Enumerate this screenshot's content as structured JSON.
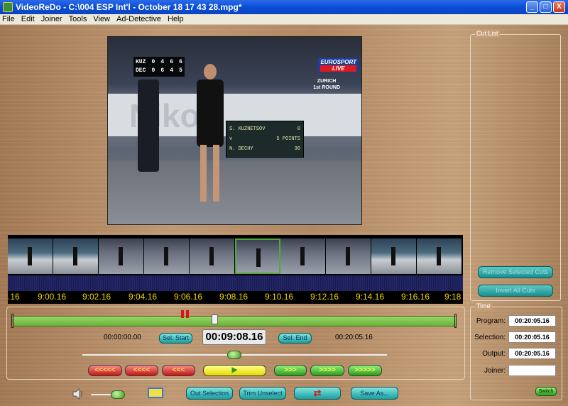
{
  "window": {
    "title": "VideoReDo - C:\\004   ESP Int'l - October 18 17 43 28.mpg*",
    "minimize": "_",
    "maximize": "□",
    "close": "X"
  },
  "menu": [
    "File",
    "Edit",
    "Joiner",
    "Tools",
    "View",
    "Ad-Detective",
    "Help"
  ],
  "video": {
    "score_row1": {
      "abbr": "KUZ",
      "a": "0",
      "b": "4",
      "c": "6",
      "d": "6"
    },
    "score_row2": {
      "abbr": "DEC",
      "a": "0",
      "b": "6",
      "c": "4",
      "d": "5"
    },
    "channel": "EUROSPORT",
    "live": "LIVE",
    "location": "ZURICH",
    "round": "1st ROUND",
    "banner": "Nikon",
    "scoreboard_p1": "S. KUZNETSOV",
    "scoreboard_p1_score": "0",
    "scoreboard_p2": "N. DECHY",
    "scoreboard_p2_score": "30",
    "scoreboard_mid": "v",
    "scoreboard_points": "5 POINTS"
  },
  "timeline": {
    "labels": [
      ".16",
      "9:00.16",
      "9:02.16",
      "9:04.16",
      "9:06.16",
      "9:08.16",
      "9:10.16",
      "9:12.16",
      "9:14.16",
      "9:16.16",
      "9:18"
    ]
  },
  "controls": {
    "selection_start": "00:00:00.00",
    "sel_start_label": "Sel. Start",
    "current_time": "00:09:08.16",
    "sel_end_label": "Sel. End",
    "selection_end": "00:20:05.16",
    "nav_back": [
      "<<<<<",
      "<<<<",
      "<<<"
    ],
    "play": "▶",
    "nav_forward": [
      ">>>",
      ">>>>",
      ">>>>>"
    ],
    "out_selection": "Out Selection",
    "trim_unselect": "Trim Unselect",
    "cycle": "⇄",
    "save_as": "Save As..."
  },
  "cut_list": {
    "title": "Cut List",
    "remove_selected": "Remove Selected Cuts",
    "invert_all": "Invert All Cuts"
  },
  "time_panel": {
    "title": "Time",
    "program_label": "Program:",
    "program_value": "00:20:05.16",
    "selection_label": "Selection:",
    "selection_value": "00:20:05.16",
    "output_label": "Output:",
    "output_value": "00:20:05.16",
    "joiner_label": "Joiner:",
    "joiner_value": "",
    "switch_label": "Switch"
  }
}
